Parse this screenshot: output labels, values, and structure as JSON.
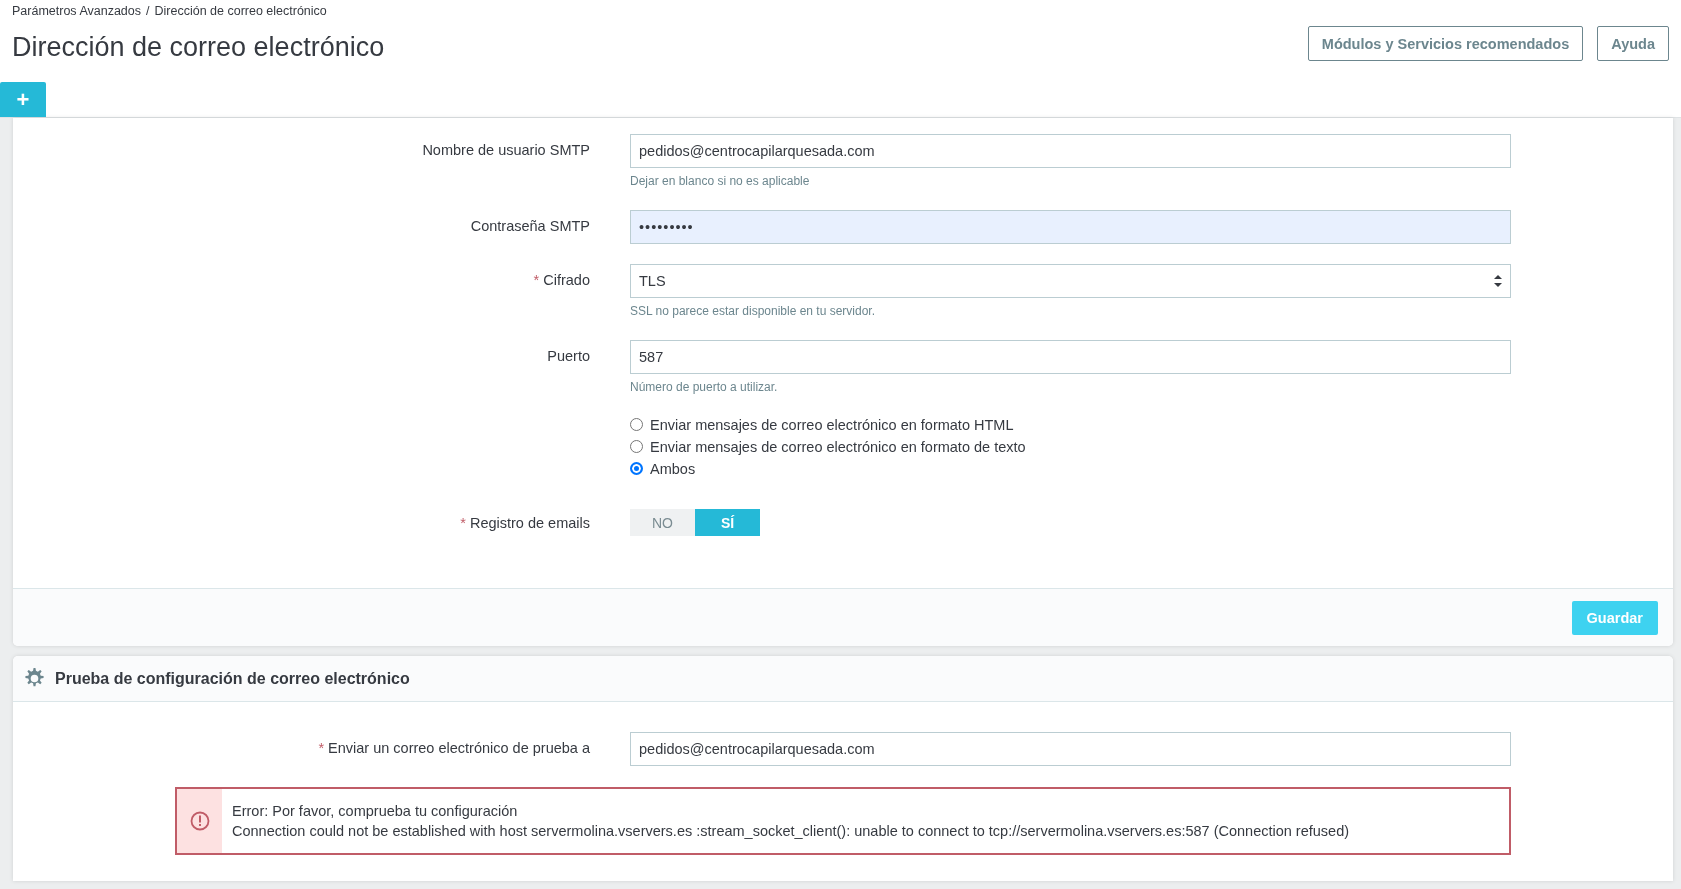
{
  "breadcrumb": [
    {
      "label": "Parámetros Avanzados",
      "separator": "/"
    },
    {
      "label": "Dirección de correo electrónico"
    }
  ],
  "page_title": "Dirección de correo electrónico",
  "header_buttons": [
    "Módulos y Servicios recomendados",
    "Ayuda"
  ],
  "add_button": "+",
  "config_form": {
    "fields": [
      {
        "kind": "text",
        "label": "Nombre de usuario SMTP",
        "value": "pedidos@centrocapilarquesada.com",
        "help": "Dejar en blanco si no es aplicable"
      },
      {
        "kind": "password",
        "label": "Contraseña SMTP",
        "value": "•••••••••"
      },
      {
        "kind": "select",
        "label": "Cifrado",
        "required_mark": "*",
        "value": "TLS",
        "help": "SSL no parece estar disponible en tu servidor."
      },
      {
        "kind": "text",
        "label": "Puerto",
        "value": "587",
        "help": "Número de puerto a utilizar."
      },
      {
        "kind": "radio",
        "options": [
          {
            "label": "Enviar mensajes de correo electrónico en formato HTML",
            "selected": false
          },
          {
            "label": "Enviar mensajes de correo electrónico en formato de texto",
            "selected": false
          },
          {
            "label": "Ambos",
            "selected": true
          }
        ]
      },
      {
        "kind": "switch",
        "label": "Registro de emails",
        "required_mark": "*",
        "options": [
          {
            "label": "NO",
            "selected": false
          },
          {
            "label": "SÍ",
            "selected": true
          }
        ]
      }
    ],
    "save_button": "Guardar"
  },
  "test_panel": {
    "title": "Prueba de configuración de correo electrónico",
    "field": {
      "label": "Enviar un correo electrónico de prueba a",
      "required_mark": "*",
      "value": "pedidos@centrocapilarquesada.com"
    },
    "error": {
      "title": "Error: Por favor, comprueba tu configuración",
      "message": "Connection could not be established with host servermolina.vservers.es :stream_socket_client(): unable to connect to tcp://servermolina.vservers.es:587 (Connection refused)"
    }
  }
}
